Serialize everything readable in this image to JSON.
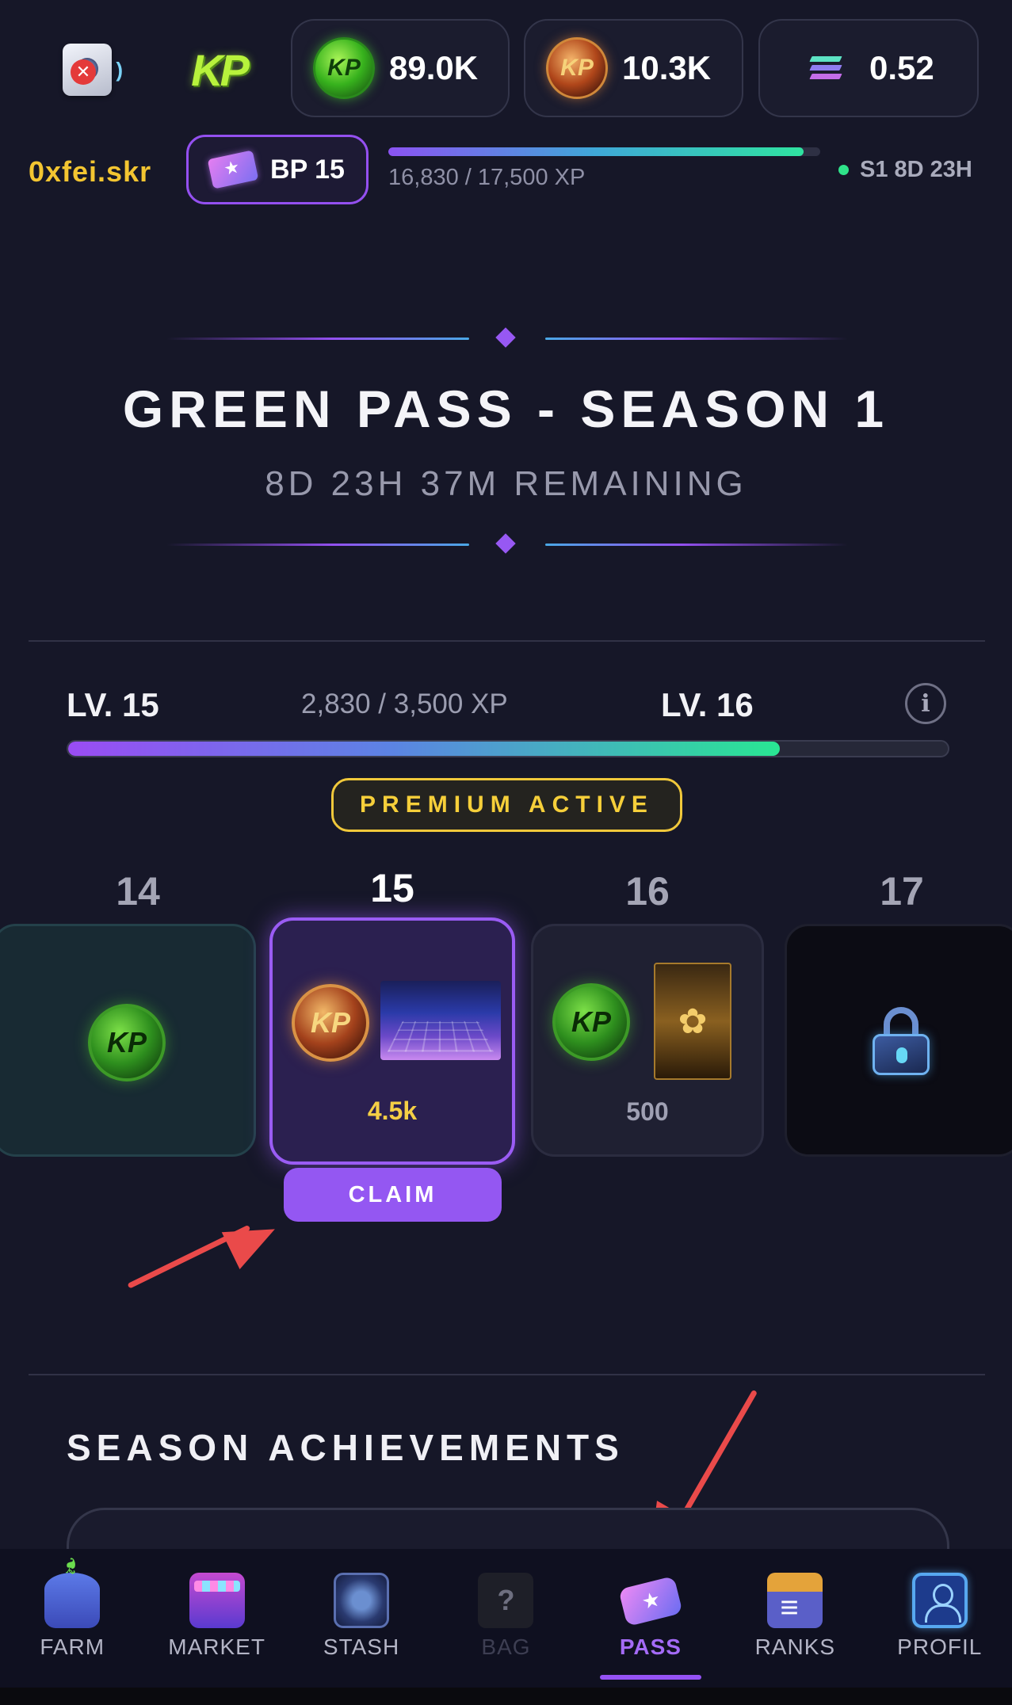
{
  "header": {
    "kp_logo": "KP",
    "currencies": [
      {
        "icon": "kush-coin-green-icon",
        "value": "89.0K"
      },
      {
        "icon": "kash-coin-gold-icon",
        "value": "10.3K"
      },
      {
        "icon": "solana-icon",
        "value": "0.52"
      }
    ]
  },
  "user": {
    "name": "0xfei.skr",
    "bp_label": "BP 15",
    "xp_text": "16,830 / 17,500 XP",
    "xp_progress": 0.962,
    "season_status": "S1 8D 23H"
  },
  "pass": {
    "title": "GREEN PASS - SEASON 1",
    "remaining": "8D 23H 37M REMAINING"
  },
  "level": {
    "current": "LV. 15",
    "next": "LV. 16",
    "xp_text": "2,830 / 3,500 XP",
    "progress": 0.809,
    "premium_label": "PREMIUM ACTIVE"
  },
  "rewards": [
    {
      "level": "14",
      "amount": "",
      "state": "claimed"
    },
    {
      "level": "15",
      "amount": "4.5k",
      "state": "claimable"
    },
    {
      "level": "16",
      "amount": "500",
      "state": "upcoming"
    },
    {
      "level": "17",
      "amount": "",
      "state": "locked"
    }
  ],
  "claim_label": "CLAIM",
  "achievements": {
    "title": "SEASON ACHIEVEMENTS"
  },
  "nav": {
    "items": [
      {
        "label": "FARM",
        "icon": "farm-icon",
        "state": "normal"
      },
      {
        "label": "MARKET",
        "icon": "market-icon",
        "state": "normal"
      },
      {
        "label": "STASH",
        "icon": "stash-icon",
        "state": "normal"
      },
      {
        "label": "BAG",
        "icon": "bag-icon",
        "state": "disabled"
      },
      {
        "label": "PASS",
        "icon": "pass-icon",
        "state": "active"
      },
      {
        "label": "RANKS",
        "icon": "ranks-icon",
        "state": "normal"
      },
      {
        "label": "PROFIL",
        "icon": "profile-icon",
        "state": "normal"
      }
    ]
  },
  "colors": {
    "accent": "#9457f2",
    "premium": "#f0c83b",
    "username": "#f3c531",
    "annotation_arrow": "#ea4a4a"
  }
}
